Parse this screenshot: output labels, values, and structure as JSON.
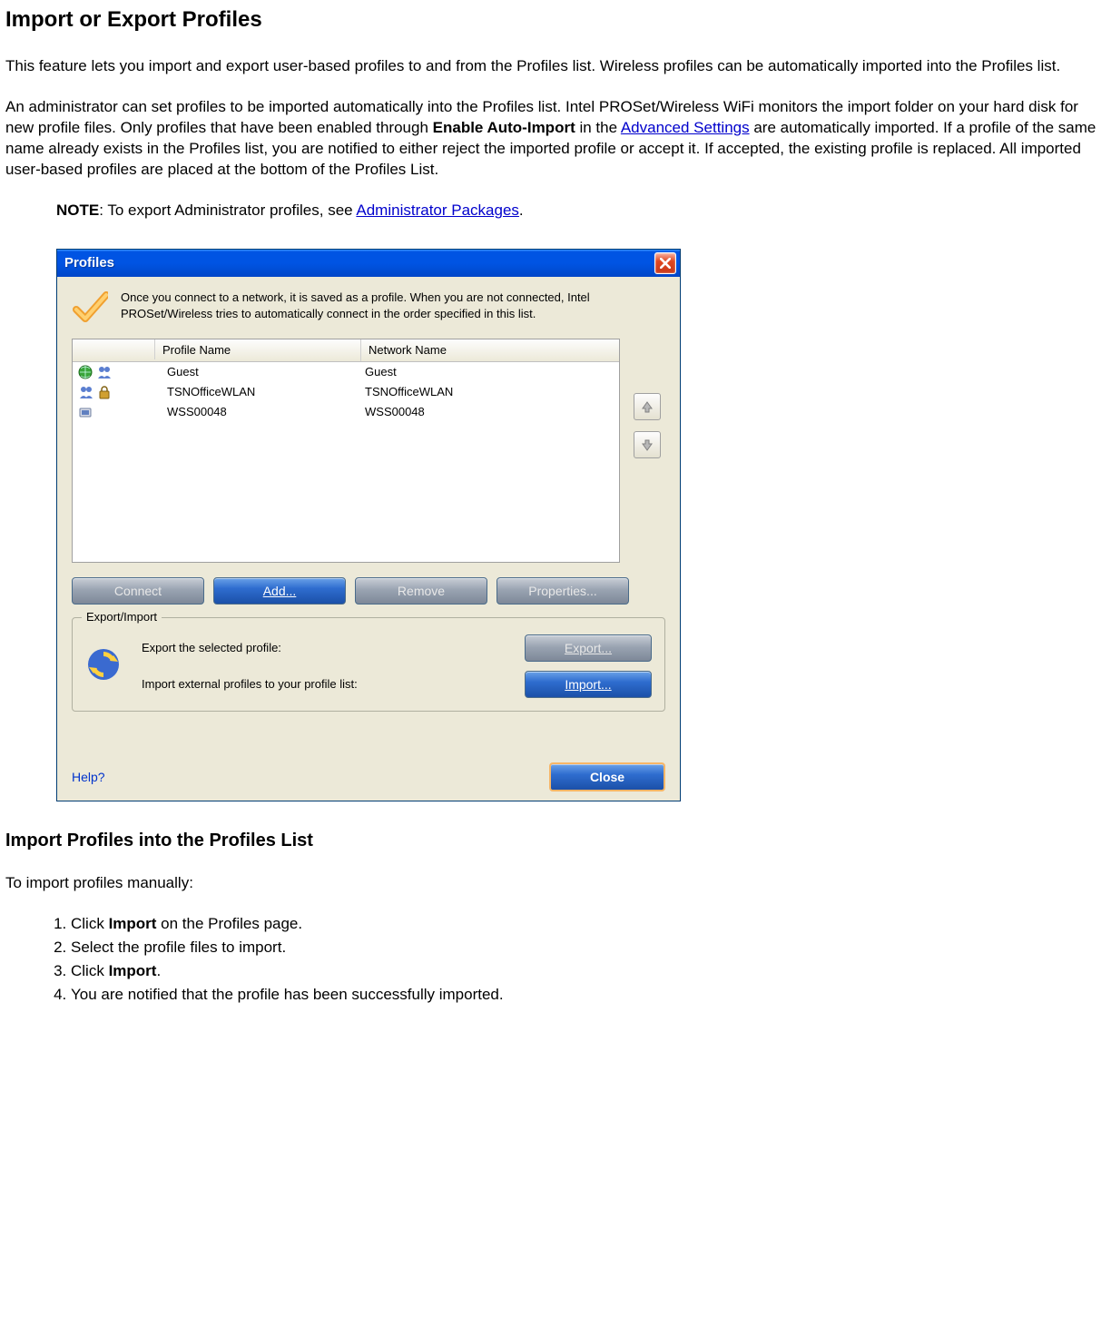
{
  "page": {
    "title": "Import or Export Profiles",
    "p1": "This feature lets you import and export user-based profiles to and from the Profiles list. Wireless profiles can be automatically imported into the Profiles list.",
    "p2_pre": "An administrator can set profiles to be imported automatically into the Profiles list. Intel PROSet/Wireless WiFi monitors the import folder on your hard disk for new profile files. Only profiles that have been enabled through ",
    "p2_bold": "Enable Auto-Import",
    "p2_mid": " in the ",
    "p2_link": "Advanced Settings",
    "p2_post": " are automatically imported. If a profile of the same name already exists in the Profiles list, you are notified to either reject the imported profile or accept it. If accepted, the existing profile is replaced. All imported user-based profiles are placed at the bottom of the Profiles List.",
    "note_label": "NOTE",
    "note_text": ": To export Administrator profiles, see ",
    "note_link": "Administrator Packages",
    "note_after": "."
  },
  "dialog": {
    "title": "Profiles",
    "intro": "Once you connect to a network, it is saved as a profile. When you are not connected, Intel PROSet/Wireless tries to automatically connect in the order specified in this list.",
    "columns": {
      "profile": "Profile Name",
      "network": "Network Name"
    },
    "rows": [
      {
        "profile": "Guest",
        "network": "Guest",
        "icons": [
          "globe",
          "people"
        ]
      },
      {
        "profile": "TSNOfficeWLAN",
        "network": "TSNOfficeWLAN",
        "icons": [
          "people",
          "lock"
        ]
      },
      {
        "profile": "WSS00048",
        "network": "WSS00048",
        "icons": [
          "device"
        ]
      }
    ],
    "buttons": {
      "connect": "Connect",
      "add": "Add...",
      "remove": "Remove",
      "properties": "Properties..."
    },
    "group": {
      "legend": "Export/Import",
      "export_text": "Export the selected profile:",
      "import_text": "Import external profiles to your profile list:",
      "export_btn": "Export...",
      "import_btn": "Import..."
    },
    "help": "Help?",
    "close": "Close"
  },
  "section2": {
    "title": "Import Profiles into the Profiles List",
    "intro": "To import profiles manually:",
    "steps": [
      {
        "pre": "Click ",
        "bold": "Import",
        "post": " on the Profiles page."
      },
      {
        "pre": "Select the profile files to import.",
        "bold": "",
        "post": ""
      },
      {
        "pre": "Click ",
        "bold": "Import",
        "post": "."
      },
      {
        "pre": "You are notified that the profile has been successfully imported.",
        "bold": "",
        "post": ""
      }
    ]
  }
}
